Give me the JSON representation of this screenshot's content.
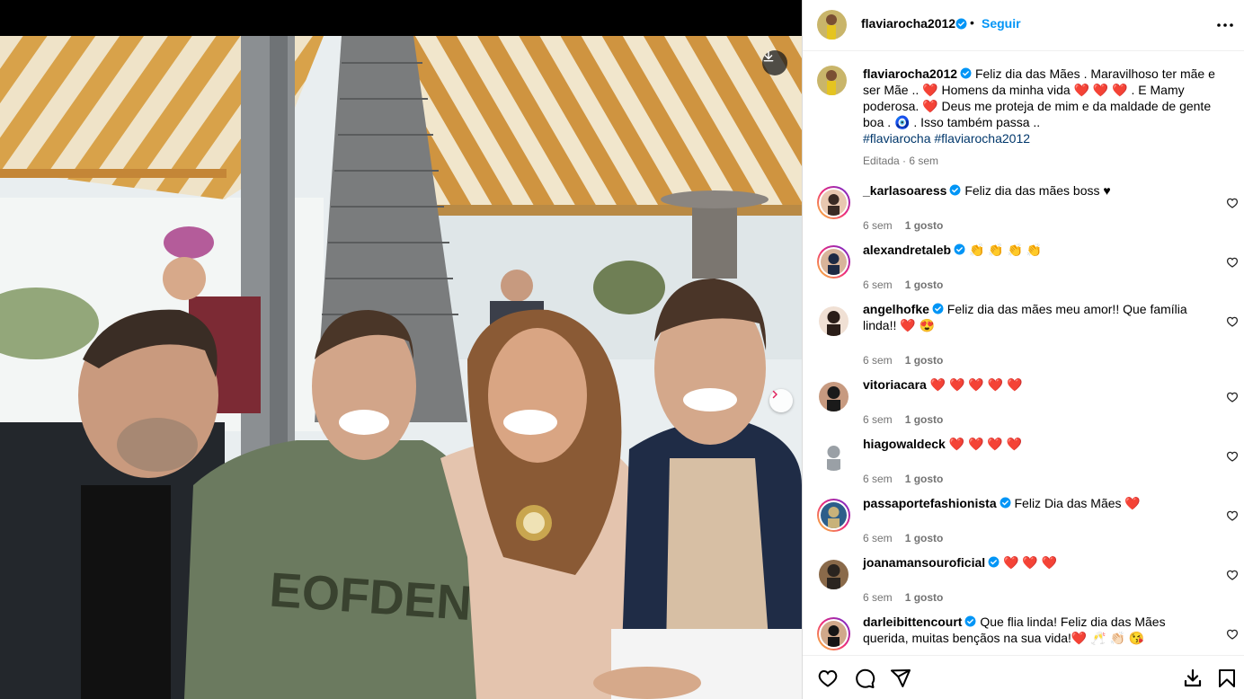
{
  "post": {
    "author": "flaviarocha2012",
    "follow_label": "Seguir",
    "separator": "•",
    "caption": "Feliz dia das Mães . Maravilhoso ter mãe e ser Mãe .. ❤️  Homens da minha vida ❤️ ❤️ ❤️ . E Mamy poderosa. ❤️ Deus me proteja de mim e da maldade de gente boa . 🧿 . Isso também passa ..",
    "hashtags": "#flaviarocha #flaviarocha2012",
    "edited_label": "Editada · 6 sem"
  },
  "comments": [
    {
      "user": "_karlasoaress",
      "verified": true,
      "text": "Feliz dia das mães boss ♥",
      "age": "6 sem",
      "likes": "1 gosto"
    },
    {
      "user": "alexandretaleb",
      "verified": true,
      "text": "👏 👏 👏 👏",
      "age": "6 sem",
      "likes": "1 gosto"
    },
    {
      "user": "angelhofke",
      "verified": true,
      "text": "Feliz dia das mães meu amor!! Que família linda!! ❤️ 😍",
      "age": "6 sem",
      "likes": "1 gosto"
    },
    {
      "user": "vitoriacara",
      "verified": false,
      "text": "❤️ ❤️ ❤️ ❤️ ❤️",
      "age": "6 sem",
      "likes": "1 gosto"
    },
    {
      "user": "hiagowaldeck",
      "verified": false,
      "text": "❤️ ❤️ ❤️ ❤️",
      "age": "6 sem",
      "likes": "1 gosto"
    },
    {
      "user": "passaportefashionista",
      "verified": true,
      "text": "Feliz Dia das Mães ❤️",
      "age": "6 sem",
      "likes": "1 gosto"
    },
    {
      "user": "joanamansouroficial",
      "verified": true,
      "text": "❤️ ❤️ ❤️",
      "age": "6 sem",
      "likes": "1 gosto"
    },
    {
      "user": "darleibittencourt",
      "verified": true,
      "text": "Que flia linda! Feliz dia das Mães querida, muitas bençãos na sua vida!❤️ 🥂 👏🏻 😘",
      "age": "",
      "likes": ""
    }
  ],
  "icons": {
    "download": "download-icon",
    "next": "chevron-right-icon",
    "more": "more-options-icon",
    "like": "heart-icon",
    "comment": "comment-icon",
    "share": "send-icon",
    "save_download": "download-icon",
    "bookmark": "bookmark-icon"
  },
  "colors": {
    "link_blue": "#0095f6",
    "hashtag_blue": "#00376b",
    "meta_gray": "#737373",
    "heart_red": "#e0245e"
  }
}
